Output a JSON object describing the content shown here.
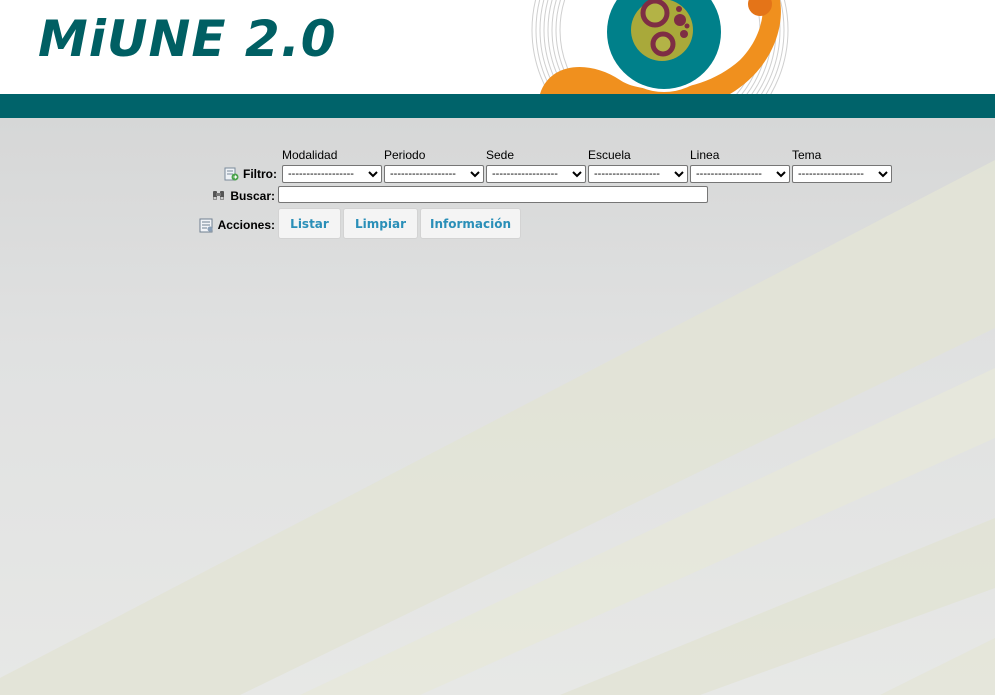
{
  "header": {
    "logo_text": "MiUNE 2.0"
  },
  "filters": {
    "row_label": "Filtro:",
    "columns": [
      {
        "label": "Modalidad",
        "value": "------------------"
      },
      {
        "label": "Periodo",
        "value": "------------------"
      },
      {
        "label": "Sede",
        "value": "------------------"
      },
      {
        "label": "Escuela",
        "value": "------------------"
      },
      {
        "label": "Linea",
        "value": "------------------"
      },
      {
        "label": "Tema",
        "value": "------------------"
      }
    ]
  },
  "search": {
    "row_label": "Buscar:",
    "value": ""
  },
  "actions": {
    "row_label": "Acciones:",
    "listar": "Listar",
    "limpiar": "Limpiar",
    "informacion": "Información"
  },
  "colors": {
    "brand_teal": "#00636a",
    "accent_orange": "#f0901e",
    "button_text": "#2a8fb8"
  },
  "icons": [
    "filter-icon",
    "binoculars-icon",
    "actions-icon"
  ]
}
